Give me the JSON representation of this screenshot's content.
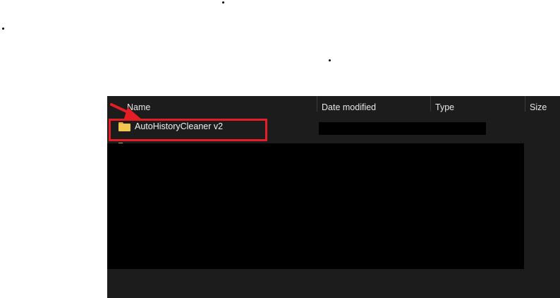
{
  "explorer": {
    "columns": {
      "name": "Name",
      "date_modified": "Date modified",
      "type": "Type",
      "size": "Size"
    },
    "rows": [
      {
        "name": "AutoHistoryCleaner v2",
        "icon": "folder-icon"
      }
    ]
  },
  "annotation": {
    "highlight_color": "#e51e25",
    "arrow_color": "#e51e25"
  },
  "colors": {
    "explorer_background": "#1c1c1c",
    "folder_icon": "#f5c64d",
    "redaction": "#000000"
  }
}
